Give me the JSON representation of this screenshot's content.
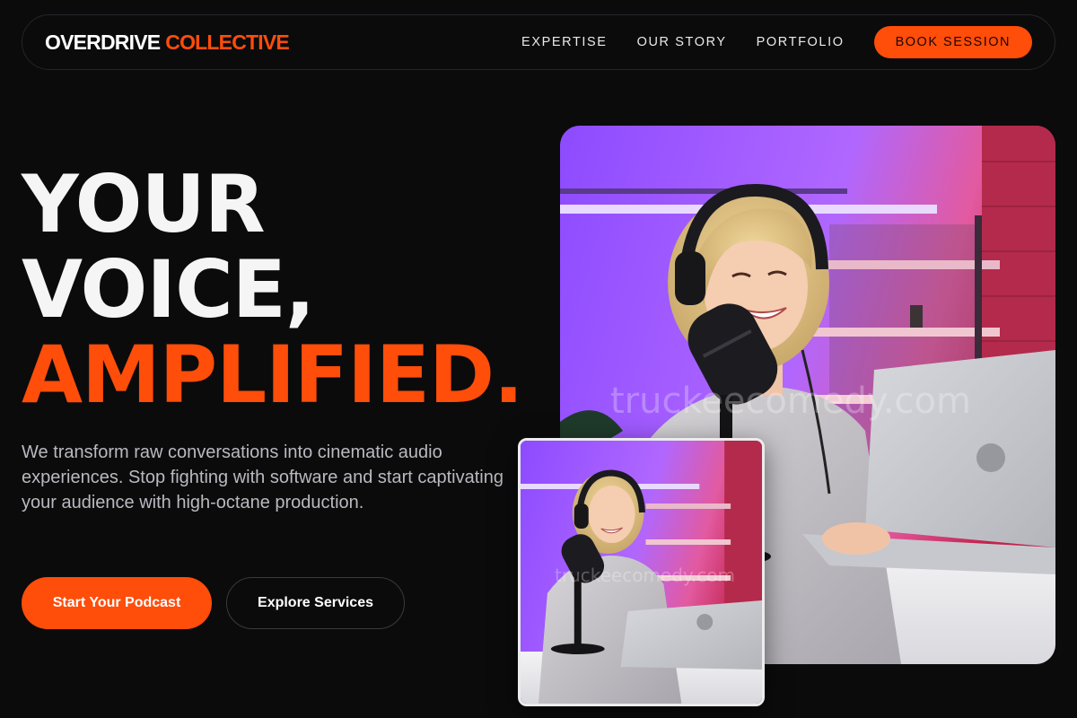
{
  "nav": {
    "logo_part1": "OVERDRIVE",
    "logo_part2": "COLLECTIVE",
    "links": [
      "EXPERTISE",
      "OUR STORY",
      "PORTFOLIO"
    ],
    "cta": "BOOK SESSION"
  },
  "hero": {
    "line1": "YOUR",
    "line2": "VOICE,",
    "line3": "AMPLIFIED.",
    "lead": "We transform raw conversations into cinematic audio experiences. Stop fighting with software and start captivating your audience with high-octane production.",
    "primary_button": "Start Your Podcast",
    "secondary_button": "Explore Services"
  },
  "images": {
    "main_watermark": "truckeecomedy.com",
    "thumb_watermark": "truckeecomedy.com"
  },
  "colors": {
    "accent": "#ff4d0a",
    "background": "#0b0b0c",
    "text": "#f5f5f5",
    "muted": "#b9b9bf"
  }
}
